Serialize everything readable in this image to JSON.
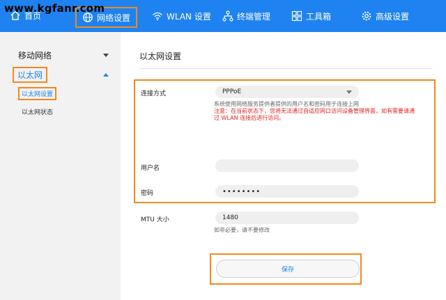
{
  "watermark": "www.kgfanr.com",
  "nav": {
    "home": "首页",
    "network": "网络设置",
    "wlan": "WLAN 设置",
    "terminal": "终端管理",
    "toolbox": "工具箱",
    "advanced": "高级设置"
  },
  "sidebar": {
    "mobile": "移动网络",
    "ethernet": "以太网",
    "eth_settings": "以太网设置",
    "eth_status": "以太网状态"
  },
  "main": {
    "title": "以太网设置",
    "conn_label": "连接方式",
    "conn_value": "PPPoE",
    "conn_hint": "系统使用网络服务提供者提供的用户名和密码用于连接上网",
    "warn_line1": "注意：在当前状态下，您将无法通过自适应网口访问设备管理界面，如有需要请通",
    "warn_line2": "过 WLAN 连接后进行访问。",
    "user_label": "用户名",
    "user_value": "",
    "pass_label": "密码",
    "pass_value": "••••••••",
    "mtu_label": "MTU 大小",
    "mtu_value": "1480",
    "mtu_hint": "如非必要，请不要修改",
    "save": "保存"
  },
  "colors": {
    "nav_bg": "#1e83f0",
    "highlight": "#f08a1c",
    "warning": "#e02020"
  }
}
